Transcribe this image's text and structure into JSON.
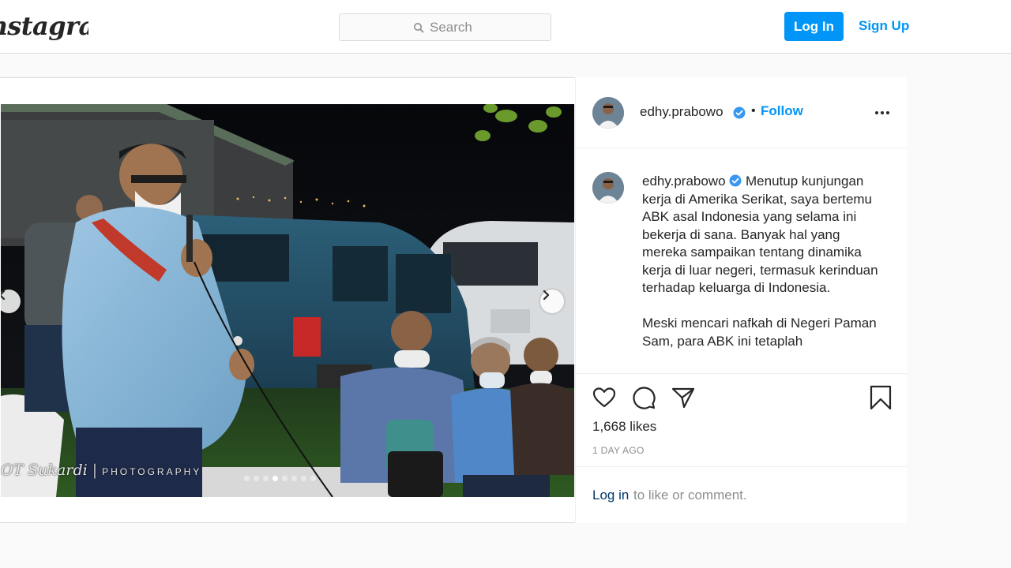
{
  "nav": {
    "logo_text": "Instagram",
    "search_placeholder": "Search",
    "login_label": "Log In",
    "signup_label": "Sign Up"
  },
  "post": {
    "media": {
      "photo_credit_name": "OT Sukardi",
      "photo_credit_tag": "PHOTOGRAPHY",
      "carousel_count": 8,
      "carousel_active_index": 3,
      "prev_icon": "chevron-left-icon",
      "next_icon": "chevron-right-icon"
    },
    "author": {
      "username": "edhy.prabowo",
      "verified": true,
      "bullet": "•",
      "follow_label": "Follow"
    },
    "caption": {
      "username": "edhy.prabowo",
      "paragraphs": [
        "Menutup kunjungan kerja di Amerika Serikat, saya bertemu ABK asal Indonesia yang selama ini bekerja di sana. Banyak hal yang mereka sampaikan tentang dinamika kerja di luar negeri, termasuk kerinduan terhadap keluarga di Indonesia.",
        "Meski mencari nafkah di Negeri Paman Sam, para ABK ini tetaplah"
      ]
    },
    "actions": {
      "icons": [
        "heart-icon",
        "comment-icon",
        "share-icon",
        "bookmark-icon"
      ],
      "likes_text": "1,668 likes",
      "timestamp": "1 DAY AGO"
    },
    "comment_prompt": {
      "login_link": "Log in",
      "rest": "to like or comment."
    }
  },
  "colors": {
    "brand_blue": "#0095f6",
    "link_dark": "#00376b",
    "border": "#dbdbdb",
    "muted": "#8e8e8e",
    "verified": "#3897f0"
  }
}
